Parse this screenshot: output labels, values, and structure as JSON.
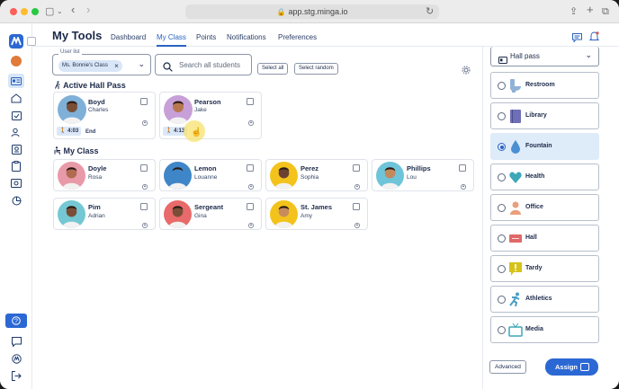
{
  "browser": {
    "url": "app.stg.minga.io"
  },
  "header": {
    "title": "My Tools",
    "nav": [
      "Dashboard",
      "My Class",
      "Points",
      "Notifications",
      "Preferences"
    ],
    "active_nav": "My Class"
  },
  "toolbar": {
    "userlist_label": "User list",
    "userlist_chip": "Ms. Bonnie's Class",
    "search_placeholder": "Search all students",
    "select_all": "Select all",
    "select_random": "Select random"
  },
  "active_hall_pass": {
    "heading": "Active Hall Pass",
    "students": [
      {
        "last": "Boyd",
        "first": "Charles",
        "timer": "4:03",
        "action": "End",
        "bg": "#7fb0d8",
        "skin": "#7a4e36"
      },
      {
        "last": "Pearson",
        "first": "Jake",
        "timer": "4:13",
        "action": "",
        "bg": "#c8a0d8",
        "skin": "#b77850"
      }
    ]
  },
  "my_class": {
    "heading": "My Class",
    "students": [
      {
        "last": "Doyle",
        "first": "Rosa",
        "bg": "#e89aa8",
        "skin": "#b06b50"
      },
      {
        "last": "Lemon",
        "first": "Louanne",
        "bg": "#3f86c8",
        "skin": "#3f86c8"
      },
      {
        "last": "Perez",
        "first": "Sophia",
        "bg": "#f3c31c",
        "skin": "#6b4030"
      },
      {
        "last": "Phillips",
        "first": "Lou",
        "bg": "#6ec4d8",
        "skin": "#c28a5c"
      },
      {
        "last": "Pim",
        "first": "Adrian",
        "bg": "#74c8d4",
        "skin": "#7a4e36"
      },
      {
        "last": "Sergeant",
        "first": "Gina",
        "bg": "#e86a6a",
        "skin": "#7a4e36"
      },
      {
        "last": "St. James",
        "first": "Amy",
        "bg": "#f3c31c",
        "skin": "#c88c5c"
      }
    ]
  },
  "hall_pass_panel": {
    "select_label": "Hall pass",
    "options": [
      {
        "label": "Restroom",
        "icon": "toilet-icon",
        "color": "#8fb2d6",
        "selected": false
      },
      {
        "label": "Library",
        "icon": "book-icon",
        "color": "#6f6fb8",
        "selected": false
      },
      {
        "label": "Fountain",
        "icon": "water-drop-icon",
        "color": "#4a8fd4",
        "selected": true
      },
      {
        "label": "Health",
        "icon": "heart-icon",
        "color": "#3ba7b8",
        "selected": false
      },
      {
        "label": "Office",
        "icon": "person-icon",
        "color": "#e8a07a",
        "selected": false
      },
      {
        "label": "Hall",
        "icon": "hall-sign-icon",
        "color": "#e06868",
        "selected": false
      },
      {
        "label": "Tardy",
        "icon": "exclamation-icon",
        "color": "#d6c31a",
        "selected": false
      },
      {
        "label": "Athletics",
        "icon": "runner-icon",
        "color": "#4a9fc4",
        "selected": false
      },
      {
        "label": "Media",
        "icon": "tv-icon",
        "color": "#3ba7b8",
        "selected": false
      }
    ],
    "advanced": "Advanced",
    "assign": "Assign"
  },
  "colors": {
    "accent": "#2b63c0",
    "brand": "#2b68d4",
    "text": "#1c2a4a"
  }
}
